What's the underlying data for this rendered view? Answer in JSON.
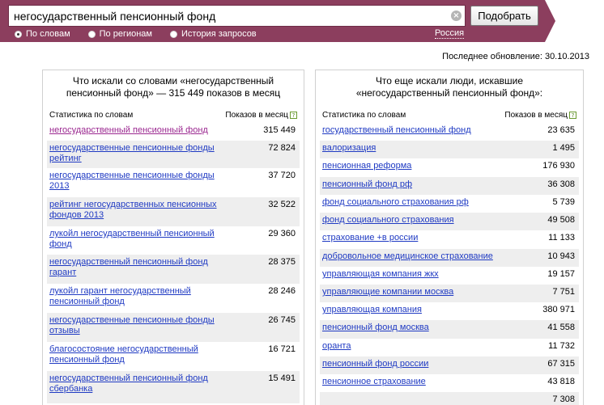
{
  "search": {
    "query": "негосударственный пенсионный фонд",
    "button_label": "Подобрать",
    "clear_glyph": "×",
    "modes": [
      {
        "label": "По словам",
        "checked": true
      },
      {
        "label": "По регионам",
        "checked": false
      },
      {
        "label": "История запросов",
        "checked": false
      }
    ],
    "region": "Россия"
  },
  "last_updated": "Последнее обновление: 30.10.2013",
  "left_panel": {
    "title_line1": "Что искали со словами «негосударственный",
    "title_line2": "пенсионный фонд» — 315 449 показов в месяц",
    "col_keywords": "Статистика по словам",
    "col_count": "Показов в месяц",
    "help_glyph": "?",
    "rows": [
      {
        "kw": "негосударственный пенсионный фонд",
        "cnt": "315 449",
        "visited": true
      },
      {
        "kw": "негосударственные пенсионные фонды рейтинг",
        "cnt": "72 824"
      },
      {
        "kw": "негосударственные пенсионные фонды 2013",
        "cnt": "37 720"
      },
      {
        "kw": "рейтинг негосударственных пенсионных фондов 2013",
        "cnt": "32 522"
      },
      {
        "kw": "лукойл негосударственный пенсионный фонд",
        "cnt": "29 360"
      },
      {
        "kw": "негосударственный пенсионный фонд гарант",
        "cnt": "28 375"
      },
      {
        "kw": "лукойл гарант негосударственный пенсионный фонд",
        "cnt": "28 246"
      },
      {
        "kw": "негосударственные пенсионные фонды отзывы",
        "cnt": "26 745"
      },
      {
        "kw": "благосостояние негосударственный пенсионный фонд",
        "cnt": "16 721"
      },
      {
        "kw": "негосударственный пенсионный фонд сбербанка",
        "cnt": "15 491"
      }
    ]
  },
  "right_panel": {
    "title_line1": "Что еще искали люди, искавшие",
    "title_line2": "«негосударственный пенсионный фонд»:",
    "col_keywords": "Статистика по словам",
    "col_count": "Показов в месяц",
    "help_glyph": "?",
    "rows": [
      {
        "kw": "государственный пенсионный фонд",
        "cnt": "23 635"
      },
      {
        "kw": "валоризация",
        "cnt": "1 495"
      },
      {
        "kw": "пенсионная реформа",
        "cnt": "176 930"
      },
      {
        "kw": "пенсионный фонд рф",
        "cnt": "36 308"
      },
      {
        "kw": "фонд социального страхования рф",
        "cnt": "5 739"
      },
      {
        "kw": "фонд социального страхования",
        "cnt": "49 508"
      },
      {
        "kw": "страхование +в россии",
        "cnt": "11 133"
      },
      {
        "kw": "добровольное медицинское страхование",
        "cnt": "10 943"
      },
      {
        "kw": "управляющая компания жкх",
        "cnt": "19 157"
      },
      {
        "kw": "управляющие компании москва",
        "cnt": "7 751"
      },
      {
        "kw": "управляющая компания",
        "cnt": "380 971"
      },
      {
        "kw": "пенсионный фонд москва",
        "cnt": "41 558"
      },
      {
        "kw": "оранта",
        "cnt": "11 732"
      },
      {
        "kw": "пенсионный фонд россии",
        "cnt": "67 315"
      },
      {
        "kw": "пенсионное страхование",
        "cnt": "43 818"
      },
      {
        "kw": "",
        "cnt": "7 308"
      }
    ]
  }
}
